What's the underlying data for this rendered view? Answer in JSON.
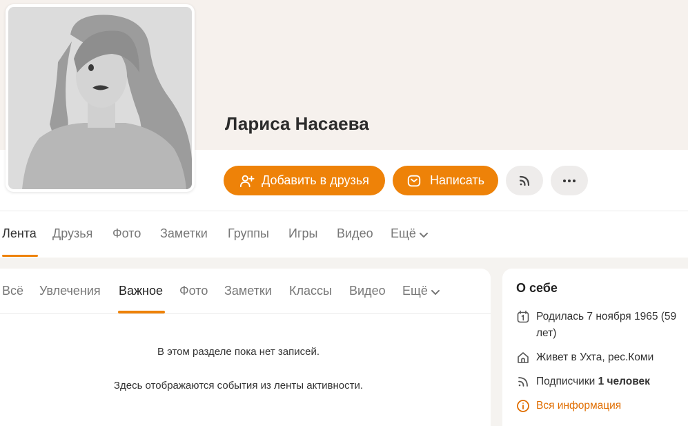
{
  "profile": {
    "name": "Лариса Насаева"
  },
  "actions": {
    "add_friend": "Добавить в друзья",
    "write": "Написать"
  },
  "nav": {
    "items": [
      "Лента",
      "Друзья",
      "Фото",
      "Заметки",
      "Группы",
      "Игры",
      "Видео",
      "Ещё"
    ]
  },
  "feed": {
    "tabs": [
      "Всё",
      "Увлечения",
      "Важное",
      "Фото",
      "Заметки",
      "Классы",
      "Видео",
      "Ещё"
    ],
    "active_tab": "Важное",
    "empty_line1": "В этом разделе пока нет записей.",
    "empty_line2": "Здесь отображаются события из ленты активности."
  },
  "about": {
    "title": "О себе",
    "birth_line1": "Родилась 7 ноября 1965 (59",
    "birth_line2": "лет)",
    "lives": "Живет в Ухта, рес.Коми",
    "subscribers_label": "Подписчики",
    "subscribers_value": "1 человек",
    "all_info": "Вся информация"
  },
  "colors": {
    "accent": "#ee8208",
    "link": "#e06d00"
  },
  "icons": [
    "add-friend-icon",
    "mail-icon",
    "rss-icon",
    "more-icon",
    "chevron-down-icon",
    "calendar-icon",
    "home-icon",
    "info-icon"
  ]
}
